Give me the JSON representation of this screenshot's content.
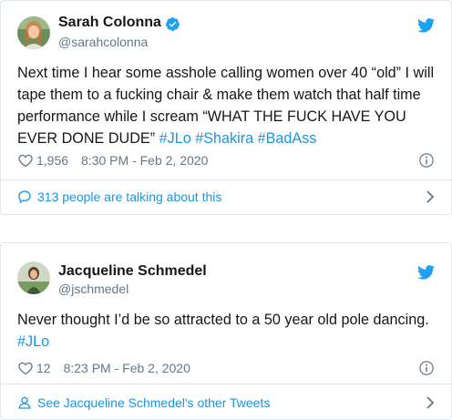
{
  "tweets": [
    {
      "author_name": "Sarah Colonna",
      "handle": "@sarahcolonna",
      "verified": true,
      "text_segments": [
        "Next time I hear some asshole calling women over 40 “old” I will tape  them to a fucking chair & make them watch that half time performance while I scream “WHAT THE FUCK HAVE YOU EVER DONE DUDE” "
      ],
      "hashtags": [
        "#JLo",
        "#Shakira",
        "#BadAss"
      ],
      "likes": "1,956",
      "timestamp": "8:30 PM - Feb 2, 2020",
      "footer_link": "313 people are talking about this",
      "footer_icon": "comment-icon"
    },
    {
      "author_name": "Jacqueline Schmedel",
      "handle": "@jschmedel",
      "verified": false,
      "text_segments": [
        "Never thought I’d be so attracted to a 50 year old pole dancing. "
      ],
      "hashtags": [
        "#JLo"
      ],
      "likes": "12",
      "timestamp": "8:23 PM - Feb 2, 2020",
      "footer_link": "See Jacqueline Schmedel's other Tweets",
      "footer_icon": "person-icon"
    }
  ],
  "colors": {
    "link_blue": "#1b95e0",
    "twitter_blue": "#1da1f2",
    "muted_gray": "#657786",
    "border": "#e1e8ed"
  }
}
